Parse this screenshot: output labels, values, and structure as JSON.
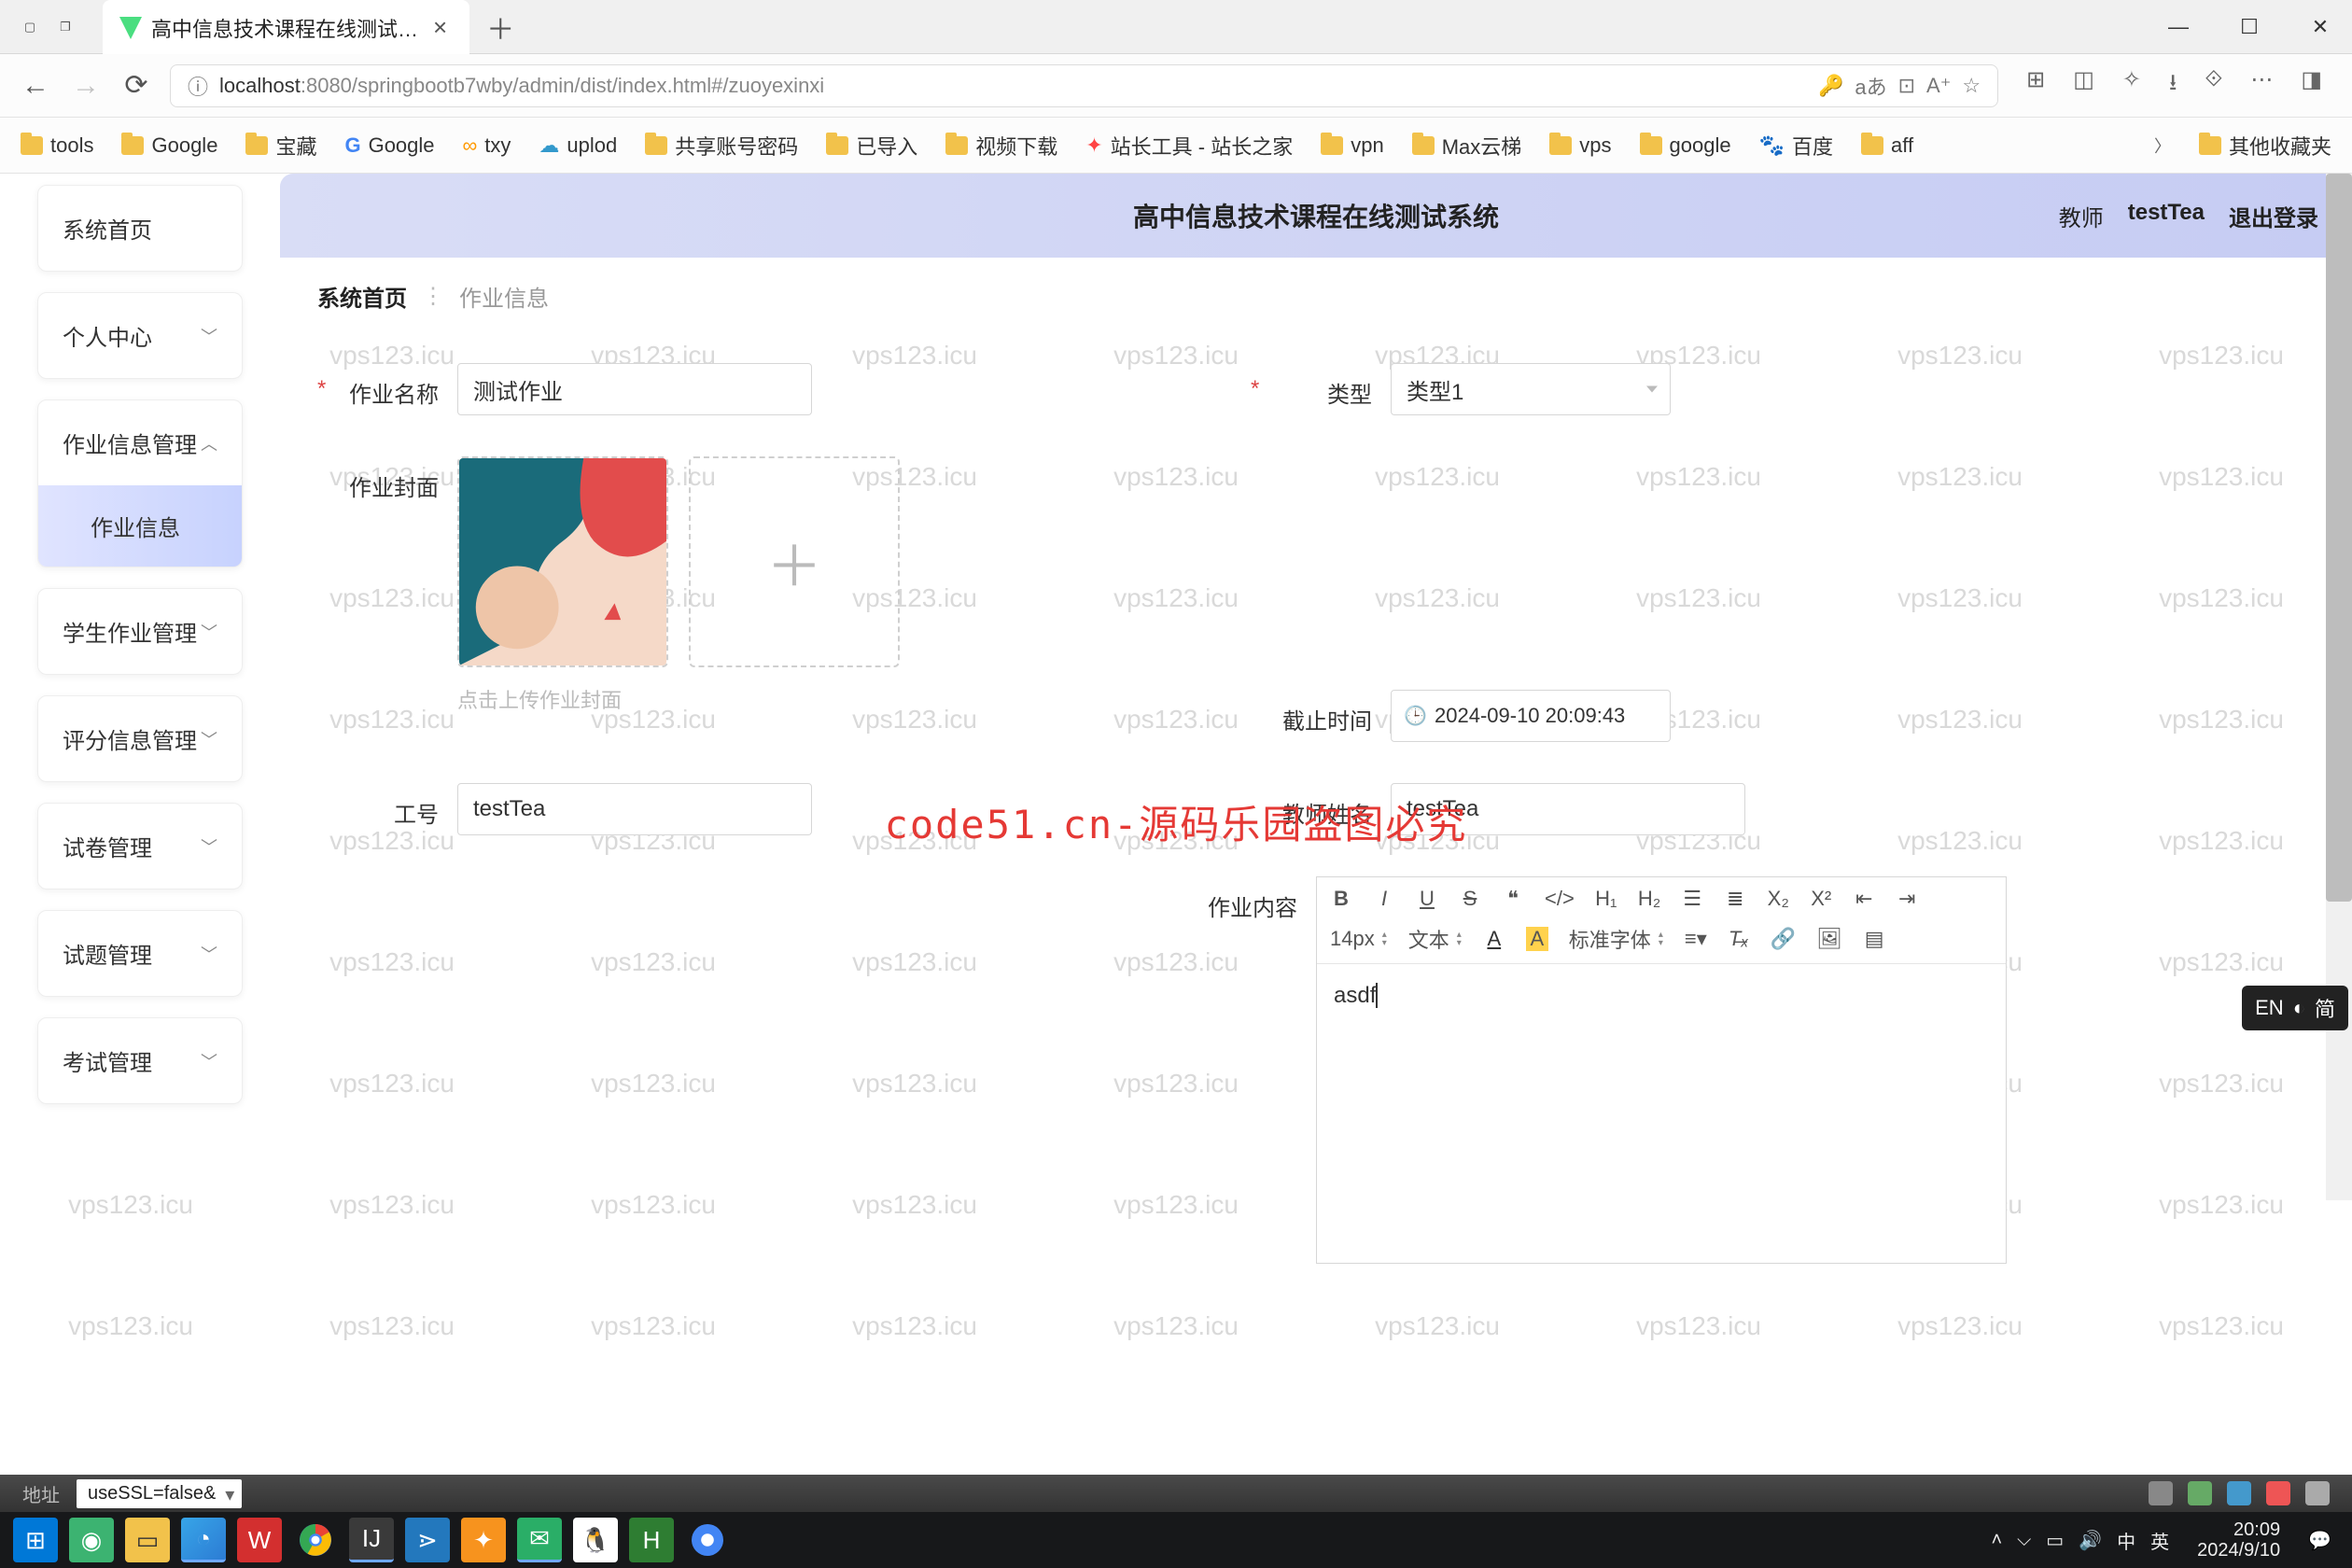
{
  "browser": {
    "tab_title": "高中信息技术课程在线测试…",
    "url_host": "localhost",
    "url_port": ":8080",
    "url_path": "/springbootb7wby/admin/dist/index.html#/zuoyexinxi"
  },
  "bookmarks": {
    "items": [
      "tools",
      "Google",
      "宝藏",
      "Google",
      "txy",
      "uplod",
      "共享账号密码",
      "已导入",
      "视频下载",
      "站长工具 - 站长之家",
      "vpn",
      "Max云梯",
      "vps",
      "google",
      "百度",
      "aff"
    ],
    "overflow": "其他收藏夹"
  },
  "watermark": "vps123.icu",
  "overlay": "code51.cn-源码乐园盗图必究",
  "sidebar": {
    "items": [
      {
        "label": "系统首页",
        "expand": false
      },
      {
        "label": "个人中心",
        "expand": true
      },
      {
        "label": "作业信息管理",
        "expand": true,
        "open": true,
        "children": [
          {
            "label": "作业信息"
          }
        ]
      },
      {
        "label": "学生作业管理",
        "expand": true
      },
      {
        "label": "评分信息管理",
        "expand": true
      },
      {
        "label": "试卷管理",
        "expand": true
      },
      {
        "label": "试题管理",
        "expand": true
      },
      {
        "label": "考试管理",
        "expand": true
      }
    ]
  },
  "header": {
    "title": "高中信息技术课程在线测试系统",
    "role": "教师",
    "username": "testTea",
    "logout": "退出登录"
  },
  "breadcrumb": {
    "home": "系统首页",
    "current": "作业信息"
  },
  "form": {
    "name_label": "作业名称",
    "name_value": "测试作业",
    "type_label": "类型",
    "type_value": "类型1",
    "cover_label": "作业封面",
    "cover_hint": "点击上传作业封面",
    "deadline_label": "截止时间",
    "deadline_value": "2024-09-10 20:09:43",
    "worknum_label": "工号",
    "worknum_value": "testTea",
    "teacher_label": "教师姓名",
    "teacher_value": "testTea",
    "content_label": "作业内容",
    "content_value": "asdf"
  },
  "editor_toolbar": {
    "font_size": "14px",
    "font_extra": "文本",
    "font_family": "标准字体",
    "h1": "H₁",
    "h2": "H₂"
  },
  "ime": {
    "lang": "EN",
    "extra": "简"
  },
  "devbar": {
    "label": "地址",
    "combo": "useSSL=false&"
  },
  "tray": {
    "time": "20:09",
    "date": "2024/9/10",
    "ime1": "中",
    "ime2": "英"
  }
}
